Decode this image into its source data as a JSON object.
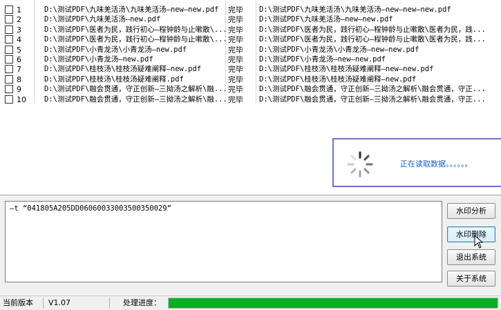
{
  "file_list": {
    "rows": [
      {
        "no": "1",
        "path": "D:\\测试PDF\\九味羌活汤\\九味羌活汤—new—new.pdf",
        "status": "完毕",
        "output": "D:\\测试PDF\\九味羌活汤\\九味羌活汤—new—new—new.pdf"
      },
      {
        "no": "2",
        "path": "D:\\测试PDF\\九味羌活汤—new.pdf",
        "status": "完毕",
        "output": "D:\\测试PDF\\九味羌活汤—new—new.pdf"
      },
      {
        "no": "3",
        "path": "D:\\测试PDF\\医者为民，践行初心—程钟龄与止嗽散\\...",
        "status": "完毕",
        "output": "D:\\测试PDF\\医者为民，践行初心—程钟龄与止嗽散\\医者为民，践..."
      },
      {
        "no": "4",
        "path": "D:\\测试PDF\\医者为民，践行初心—程钟龄与止嗽散\\...",
        "status": "完毕",
        "output": "D:\\测试PDF\\医者为民，践行初心—程钟龄与止嗽散\\医者为民，践..."
      },
      {
        "no": "5",
        "path": "D:\\测试PDF\\小青龙汤\\小青龙汤—new.pdf",
        "status": "完毕",
        "output": "D:\\测试PDF\\小青龙汤\\小青龙汤—new—new.pdf"
      },
      {
        "no": "6",
        "path": "D:\\测试PDF\\小青龙汤—new.pdf",
        "status": "完毕",
        "output": "D:\\测试PDF\\小青龙汤—new—new.pdf"
      },
      {
        "no": "7",
        "path": "D:\\测试PDF\\桂枝汤\\桂枝汤疑难阐释—new.pdf",
        "status": "完毕",
        "output": "D:\\测试PDF\\桂枝汤\\桂枝汤疑难阐释—new—new.pdf"
      },
      {
        "no": "8",
        "path": "D:\\测试PDF\\桂枝汤\\桂枝汤疑难阐释.pdf",
        "status": "完毕",
        "output": "D:\\测试PDF\\桂枝汤\\桂枝汤疑难阐释—new.pdf"
      },
      {
        "no": "9",
        "path": "D:\\测试PDF\\融会贯通，守正创新—三拗汤之解析\\融...",
        "status": "完毕",
        "output": "D:\\测试PDF\\融会贯通，守正创新—三拗汤之解析\\融会贯通，守正..."
      },
      {
        "no": "10",
        "path": "D:\\测试PDF\\融会贯通，守正创新—三拗汤之解析\\融...",
        "status": "完毕",
        "output": "D:\\测试PDF\\融会贯通，守正创新—三拗汤之解析\\融会贯通，守正..."
      }
    ]
  },
  "loading": {
    "text": "正在读取数据。。。。。。"
  },
  "command": {
    "text": "—t “041805A205DD06060033003500350029”"
  },
  "buttons": {
    "analyze": "水印分析",
    "remove": "水印删除",
    "exit": "退出系统",
    "about": "关于系统"
  },
  "status_bar": {
    "version_label": "当前版本",
    "version_value": "V1.07",
    "progress_label": "处理进度：",
    "progress_fraction": 1.0,
    "progress_color": "#06b025"
  }
}
